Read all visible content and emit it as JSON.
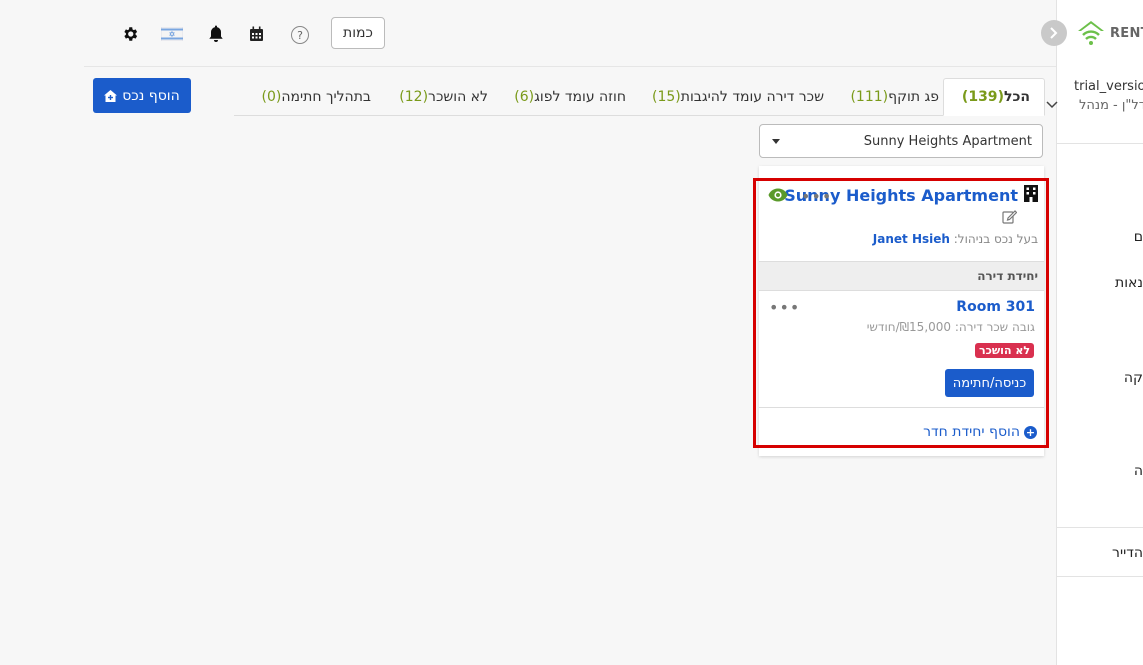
{
  "header": {
    "qty_button": "כמות",
    "icons": [
      "settings-icon",
      "language-flag-icon",
      "bell-icon",
      "calendar-icon",
      "help-icon"
    ],
    "help_glyph": "?"
  },
  "sidebar": {
    "logo_text": "RENT",
    "user": "trial_version",
    "role": "נדל\"ן - מנהל",
    "items": [
      "ם",
      "נאות",
      "קה",
      "ה",
      "הדייר"
    ]
  },
  "actions": {
    "add_property": "הוסף נכס"
  },
  "tabs": [
    {
      "label": "הכל",
      "count": "(139)",
      "active": true
    },
    {
      "label": "פג תוקף",
      "count": "(111)"
    },
    {
      "label": "שכר דירה עומד להיגבות",
      "count": "(15)"
    },
    {
      "label": "חוזה עומד לפוג",
      "count": "(6)"
    },
    {
      "label": "לא הושכר",
      "count": "(12)"
    },
    {
      "label": "בתהליך חתימה",
      "count": "(0)"
    }
  ],
  "filter": {
    "selected_property": "Sunny Heights Apartment"
  },
  "card": {
    "title": "Sunny Heights Apartment",
    "owner_label": "בעל נכס בניהול:",
    "owner_name": "Janet Hsieh",
    "unit_section": "יחידת דירה",
    "unit": {
      "name": "Room 301",
      "rent": "גובה שכר דירה: ₪15,000/חודשי",
      "status": "לא הושכר",
      "action": "כניסה/חתימה"
    },
    "add_unit": "הוסף יחידת חדר"
  },
  "colors": {
    "primary": "#1b5ccb",
    "count_green": "#7a9a1a",
    "status_red": "#d9304f",
    "highlight_red": "#d60000",
    "eye_green": "#5a9a2a"
  }
}
